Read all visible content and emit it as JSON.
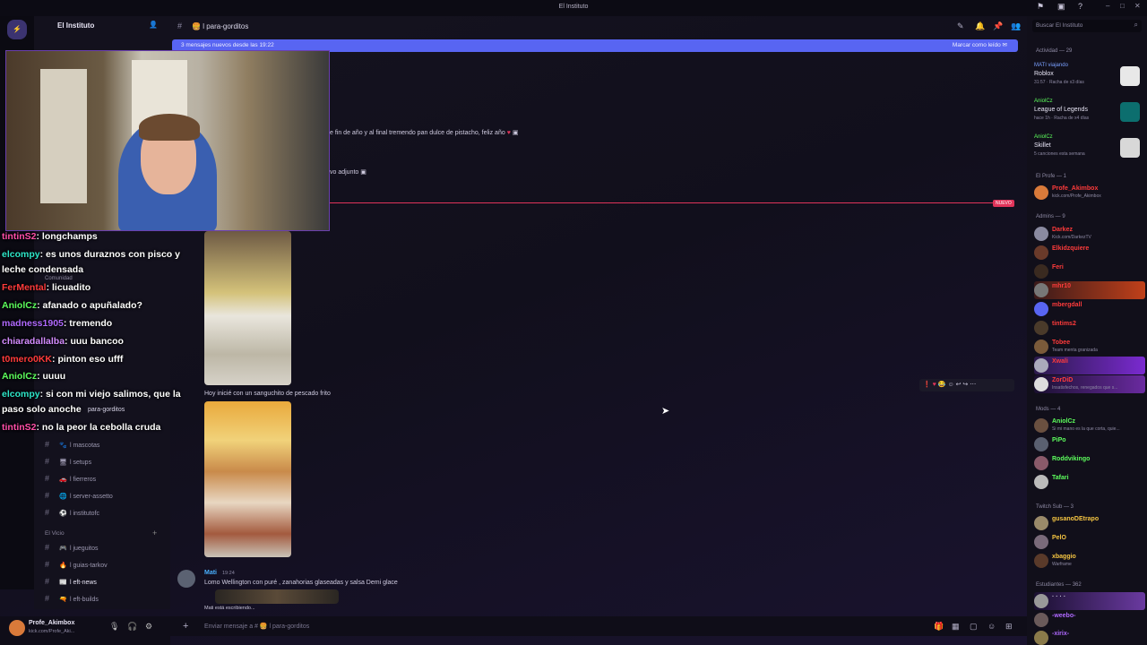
{
  "titlebar": {
    "title": "El Instituto",
    "server_icon": "instituto-server-icon"
  },
  "window_controls": {
    "minimize": "–",
    "maximize": "□",
    "close": "✕"
  },
  "server": {
    "name": "El Instituto"
  },
  "channel_header": {
    "hash": "#",
    "name": "l para-gorditos"
  },
  "new_messages_bar": {
    "text": "3 mensajes nuevos desde las 19:22",
    "mark_read": "Marcar como leído"
  },
  "messages": {
    "line1": "e fin de año y al final tremendo pan dulce de pistacho, feliz año",
    "line2": "vo adjunto",
    "new_label": "NUEVO",
    "caption": "Hoy inicié con un sanguchito de pescado frito",
    "last_author": "Mati",
    "last_time": "19:24",
    "last_text": "Lomo Wellington con puré , zanahorias glaseadas y salsa Demi glace",
    "typing": "Mati está escribiendo..."
  },
  "overlay_chat": [
    {
      "user": "tintinS2",
      "text": ": longchamps",
      "color": "#ff4fa8"
    },
    {
      "user": "elcompy",
      "text": ": es unos duraznos con pisco y",
      "color": "#2ee6c9"
    },
    {
      "user": "",
      "text": "leche condensada",
      "color": "#ffffff"
    },
    {
      "user": "FerMental",
      "text": ": licuadito",
      "color": "#ff3b3b"
    },
    {
      "user": "AniolCz",
      "text": ": afanado o apuñalado?",
      "color": "#5dff5d"
    },
    {
      "user": "madness1905",
      "text": ": tremendo",
      "color": "#b069ff"
    },
    {
      "user": "chiaradallalba",
      "text": ": uuu bancoo",
      "color": "#d48cff"
    },
    {
      "user": "t0mero0KK",
      "text": ": pinton eso ufff",
      "color": "#ff3b3b"
    },
    {
      "user": "AniolCz",
      "text": ": uuuu",
      "color": "#5dff5d"
    },
    {
      "user": "elcompy",
      "text": ": si con mi viejo salimos, que la",
      "color": "#2ee6c9"
    },
    {
      "user": "",
      "text": "paso solo anoche",
      "color": "#ffffff"
    },
    {
      "user": "tintinS2",
      "text": ": no la peor la cebolla cruda",
      "color": "#ff4fa8"
    }
  ],
  "channels_bg": {
    "comunidad": "Comunidad",
    "para_gorditos": "para-gorditos",
    "items": [
      {
        "name": "l mascotas",
        "emoji": "🐾"
      },
      {
        "name": "l setups",
        "emoji": "🖥"
      },
      {
        "name": "l fierreros",
        "emoji": "🚗"
      },
      {
        "name": "l server-assetto",
        "emoji": "🌐"
      },
      {
        "name": "l institutofc",
        "emoji": "⚽"
      }
    ],
    "category_vicio": "El Vicio",
    "vicio_items": [
      {
        "name": "l jueguitos",
        "emoji": "🎮"
      },
      {
        "name": "l guias-tarkov",
        "emoji": "🔥"
      },
      {
        "name": "l eft-news",
        "emoji": "📰"
      },
      {
        "name": "l eft-builds",
        "emoji": "🔫"
      }
    ]
  },
  "user_panel": {
    "name": "Profe_Akimbox",
    "status": "kick.com/Profe_Aki..."
  },
  "input": {
    "placeholder": "Enviar mensaje a # 🍔 l para-gorditos"
  },
  "search": {
    "placeholder": "Buscar El Instituto"
  },
  "activity": {
    "header": "Actividad — 29",
    "items": [
      {
        "user": "MATI viajando",
        "game": "Roblox",
        "detail": "31:57 · Racha de x3 días"
      },
      {
        "user": "AniolCz",
        "game": "League of Legends",
        "detail": "hace 1h · Racha de x4 días"
      },
      {
        "user": "AniolCz",
        "game": "Skillet",
        "detail": "5 canciones esta semana"
      }
    ]
  },
  "members": {
    "profe_header": "El Profe — 1",
    "profe": [
      {
        "name": "Profe_Akimbox",
        "sub": "kick.com/Profe_Akimbox",
        "color": "#ff3b3b"
      }
    ],
    "admins_header": "Admins — 9",
    "admins": [
      {
        "name": "Darkez",
        "sub": "Kick.com/DarkezTV",
        "color": "#ff3b3b"
      },
      {
        "name": "Elkidzquiere",
        "sub": "",
        "color": "#ff3b3b"
      },
      {
        "name": "Feri",
        "sub": "",
        "color": "#ff3b3b"
      },
      {
        "name": "mhr10",
        "sub": "",
        "color": "#ff3b3b"
      },
      {
        "name": "mbergdall",
        "sub": "",
        "color": "#ff3b3b"
      },
      {
        "name": "tintims2",
        "sub": "",
        "color": "#ff3b3b"
      },
      {
        "name": "Tobee",
        "sub": "Team menta granizada",
        "color": "#ff3b3b"
      },
      {
        "name": "Xwali",
        "sub": "",
        "color": "#ff3b3b"
      },
      {
        "name": "ZorDiD",
        "sub": "Insatisfechos, renegados que s...",
        "color": "#ff3b3b"
      }
    ],
    "mods_header": "Mods — 4",
    "mods": [
      {
        "name": "AniolCz",
        "sub": "Si mi mano es la que corta, quie...",
        "color": "#5dff5d"
      },
      {
        "name": "PiPo",
        "sub": "",
        "color": "#5dff5d"
      },
      {
        "name": "Roddvikingo",
        "sub": "",
        "color": "#5dff5d"
      },
      {
        "name": "Tafari",
        "sub": "",
        "color": "#5dff5d"
      }
    ],
    "subs_header": "Twitch Sub — 3",
    "subs": [
      {
        "name": "gusanoDEtrapo",
        "sub": "",
        "color": "#f5c542"
      },
      {
        "name": "PelO",
        "sub": "",
        "color": "#f5c542"
      },
      {
        "name": "xbaggio",
        "sub": "Warframe",
        "color": "#f5c542"
      }
    ],
    "students_header": "Estudiantes — 362",
    "students": [
      {
        "name": "· · · ·",
        "sub": "",
        "color": "#c9c5da"
      },
      {
        "name": "-weebo-",
        "sub": "",
        "color": "#b069ff"
      },
      {
        "name": "-xirix-",
        "sub": "",
        "color": "#b069ff"
      }
    ]
  }
}
